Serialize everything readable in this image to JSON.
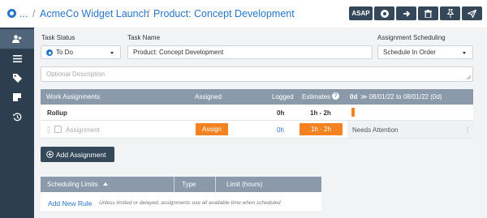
{
  "header": {
    "breadcrumb_ellipsis": "...",
    "project_link": "AcmeCo Widget Launch",
    "separator": "/",
    "task_title": "Product: Concept Development",
    "buttons": {
      "asap_label": "ASAP",
      "icons": [
        "record-icon",
        "arrow-right-icon",
        "trash-icon",
        "pin-icon",
        "send-icon"
      ]
    }
  },
  "sidebar": {
    "items": [
      "assign-user-icon",
      "list-icon",
      "tag-icon",
      "note-icon",
      "history-icon"
    ]
  },
  "form": {
    "task_status_label": "Task Status",
    "task_status_value": "To Do",
    "task_name_label": "Task Name",
    "task_name_value": "Product: Concept Development",
    "scheduling_label": "Assignment Scheduling",
    "scheduling_value": "Schedule In Order",
    "description_placeholder": "Optional Description"
  },
  "assignments": {
    "columns": {
      "work": "Work Assignments",
      "assigned": "Assigned",
      "logged": "Logged",
      "estimates": "Estimates",
      "timeline": "0d",
      "date_range": "≫ 08/01/22 to 08/01/22 (0d)"
    },
    "rollup": {
      "label": "Rollup",
      "logged": "0h",
      "estimate": "1h - 2h"
    },
    "rows": [
      {
        "name": "Assignment",
        "assign_button": "Assign",
        "logged": "0h",
        "estimate": "1h - 2h",
        "status": "Needs Attention"
      }
    ],
    "add_button": "Add Assignment"
  },
  "limits": {
    "columns": {
      "limits": "Scheduling Limits",
      "type": "Type",
      "limit": "Limit (hours)"
    },
    "add_rule": "Add New Rule",
    "hint": "Unless limited or delayed, assignments use all available time when scheduled"
  },
  "colors": {
    "accent": "#2a76c6",
    "orange": "#f58220",
    "sidebar": "#2c3e50",
    "button_dark": "#34485a",
    "table_header": "#8a9aaa"
  }
}
